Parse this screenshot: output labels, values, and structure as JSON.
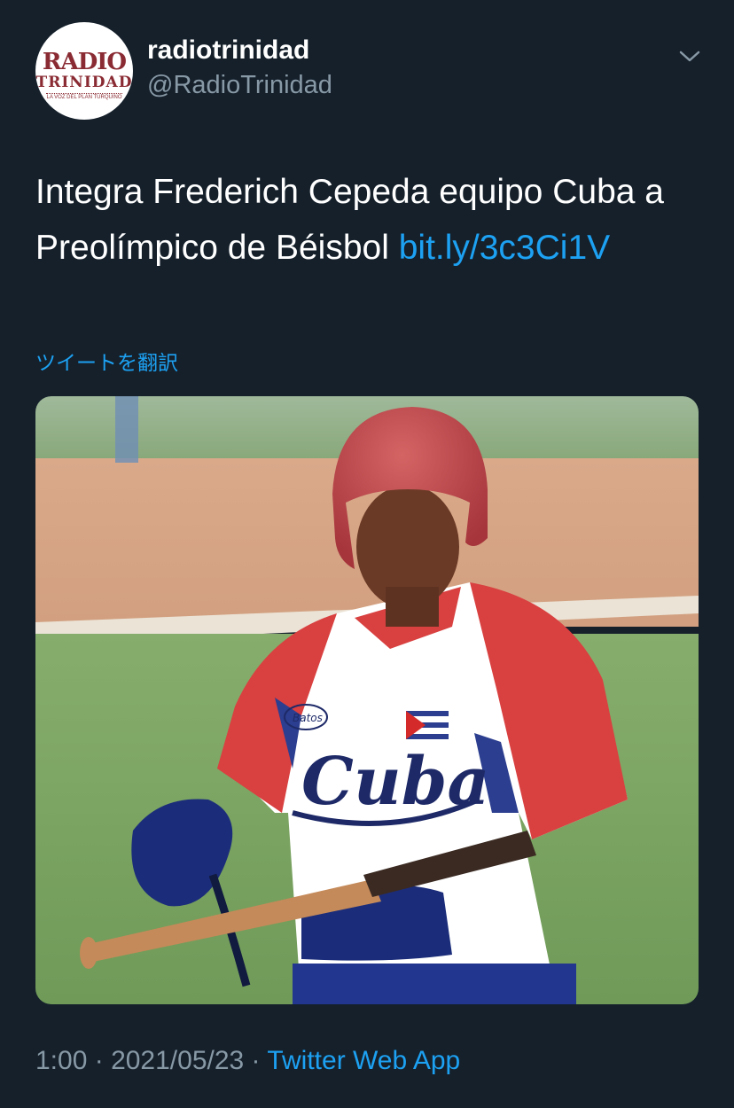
{
  "account": {
    "display_name": "radiotrinidad",
    "handle": "@RadioTrinidad",
    "avatar_text_main": "RADIO",
    "avatar_text_sub": "TRINIDAD",
    "avatar_tagline": "LA VOZ DEL PLAN TURQUINO"
  },
  "tweet": {
    "text": "Integra Frederich Cepeda equipo Cuba a Preolímpico de Béisbol ",
    "link": "bit.ly/3c3Ci1V",
    "translate_label": "ツイートを翻訳",
    "media": {
      "jersey_text": "Cuba",
      "jersey_patch": "Batos",
      "alt_icon": "photo-baseball-player"
    }
  },
  "meta": {
    "time": "1:00",
    "separator": " · ",
    "date": "2021/05/23",
    "separator2": " · ",
    "source": "Twitter Web App"
  },
  "icons": {
    "more_menu": "chevron-down-icon"
  },
  "colors": {
    "background": "#15202b",
    "link": "#1da1f2",
    "secondary_text": "#8899a6",
    "avatar_brand": "#8a2b33"
  }
}
